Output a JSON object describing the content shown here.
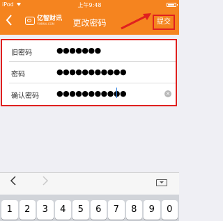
{
  "status_bar": {
    "carrier": "iPod",
    "time": "上午9:48"
  },
  "nav": {
    "back_icon": "chevron-left-icon",
    "logo_name": "亿智财讯",
    "logo_sub": "YIMMAI.COM",
    "title": "更改密码",
    "submit_label": "提交"
  },
  "form": {
    "rows": [
      {
        "label": "旧密码",
        "value": "●●●●●●●"
      },
      {
        "label": "密码",
        "value": "●●●●●●●●●●●"
      },
      {
        "label": "确认密码",
        "value": "●●●●●●●●●●●"
      }
    ]
  },
  "keyboard": {
    "keys": [
      "1",
      "2",
      "3",
      "4",
      "5",
      "6",
      "7",
      "8",
      "9",
      "0"
    ]
  },
  "colors": {
    "accent": "#f5841f",
    "highlight": "#e0201f"
  }
}
